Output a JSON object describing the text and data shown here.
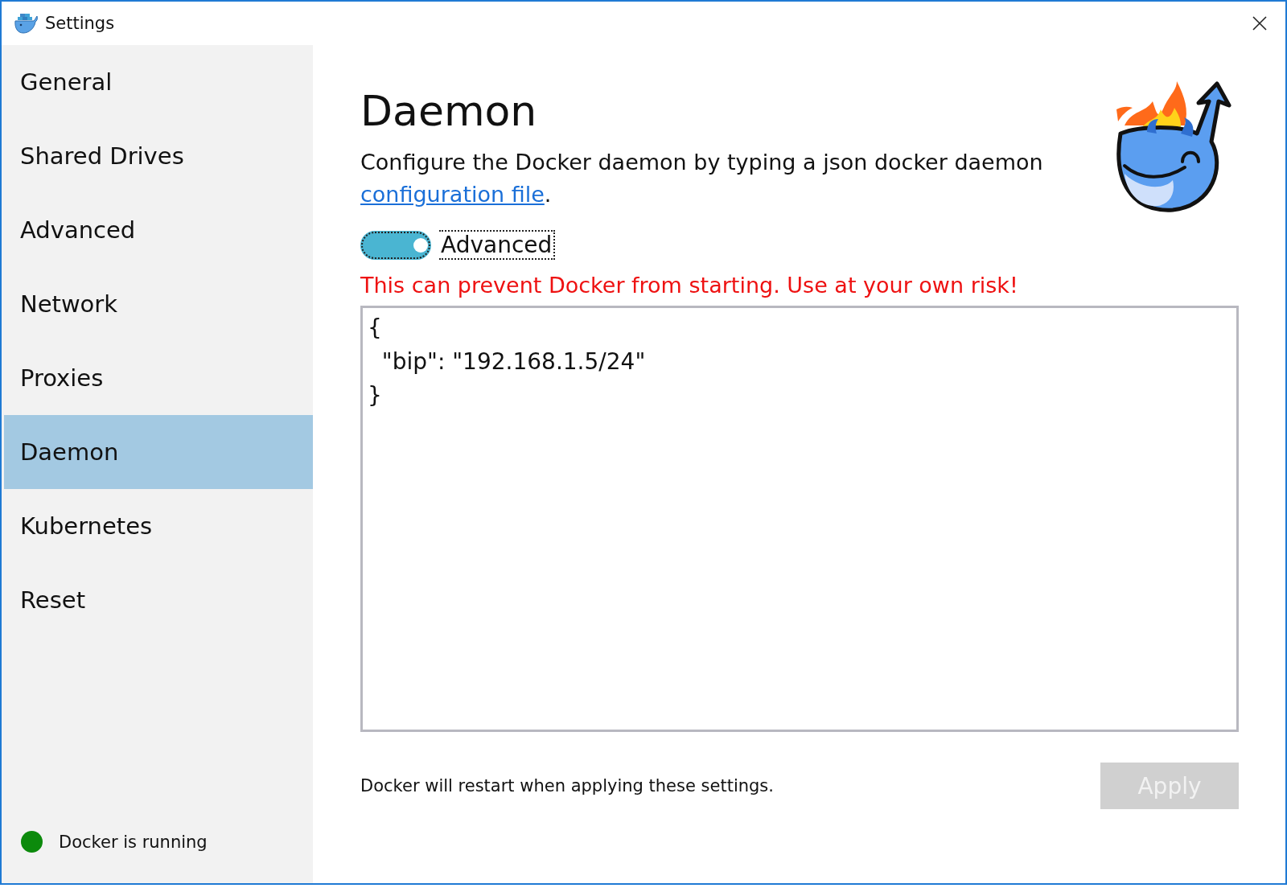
{
  "window": {
    "title": "Settings"
  },
  "sidebar": {
    "items": [
      {
        "label": "General",
        "selected": false
      },
      {
        "label": "Shared Drives",
        "selected": false
      },
      {
        "label": "Advanced",
        "selected": false
      },
      {
        "label": "Network",
        "selected": false
      },
      {
        "label": "Proxies",
        "selected": false
      },
      {
        "label": "Daemon",
        "selected": true
      },
      {
        "label": "Kubernetes",
        "selected": false
      },
      {
        "label": "Reset",
        "selected": false
      }
    ],
    "status": {
      "text": "Docker is running",
      "color": "#0c8a0c"
    }
  },
  "main": {
    "heading": "Daemon",
    "description": {
      "before": "Configure the Docker daemon by typing a json docker daemon ",
      "link": "configuration file",
      "after": "."
    },
    "toggle": {
      "label": "Advanced",
      "on": true
    },
    "warning": "This can prevent Docker from starting. Use at your own risk!",
    "editor": {
      "value": "{\n  \"bip\": \"192.168.1.5/24\"\n}"
    },
    "footer_note": "Docker will restart when applying these settings.",
    "apply_button": {
      "label": "Apply",
      "disabled": true
    }
  }
}
